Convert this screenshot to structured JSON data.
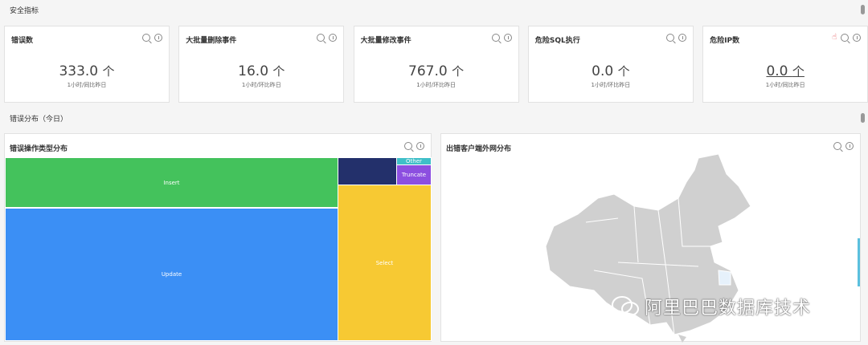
{
  "sections": {
    "security": "安全指标",
    "errors": "错误分布（今日）"
  },
  "cards": [
    {
      "title": "错误数",
      "value": "333.0",
      "unit": "个",
      "sub": "1小时/同比昨日"
    },
    {
      "title": "大批量删除事件",
      "value": "16.0",
      "unit": "个",
      "sub": "1小时/环比昨日"
    },
    {
      "title": "大批量修改事件",
      "value": "767.0",
      "unit": "个",
      "sub": "1小时/环比昨日"
    },
    {
      "title": "危险SQL执行",
      "value": "0.0",
      "unit": "个",
      "sub": "1小时/环比昨日"
    },
    {
      "title": "危险IP数",
      "value": "0.0",
      "unit": "个",
      "sub": "1小时/同比昨日"
    }
  ],
  "panels": {
    "treemap_title": "错误操作类型分布",
    "map_title": "出错客户端外网分布"
  },
  "chart_data": {
    "type": "treemap",
    "title": "错误操作类型分布",
    "items": [
      {
        "name": "Update",
        "value": 68300,
        "color": "#3b8ff5"
      },
      {
        "name": "Insert",
        "value": 25700,
        "color": "#44c25c"
      },
      {
        "name": "Select",
        "value": 22400,
        "color": "#f7c933"
      },
      {
        "name": "",
        "value": 2500,
        "color": "#23306b"
      },
      {
        "name": "Truncate",
        "value": 1050,
        "color": "#8c4fe0"
      },
      {
        "name": "Other",
        "value": 380,
        "color": "#3fbfc8"
      }
    ]
  },
  "watermark": "阿里巴巴数据库技术"
}
